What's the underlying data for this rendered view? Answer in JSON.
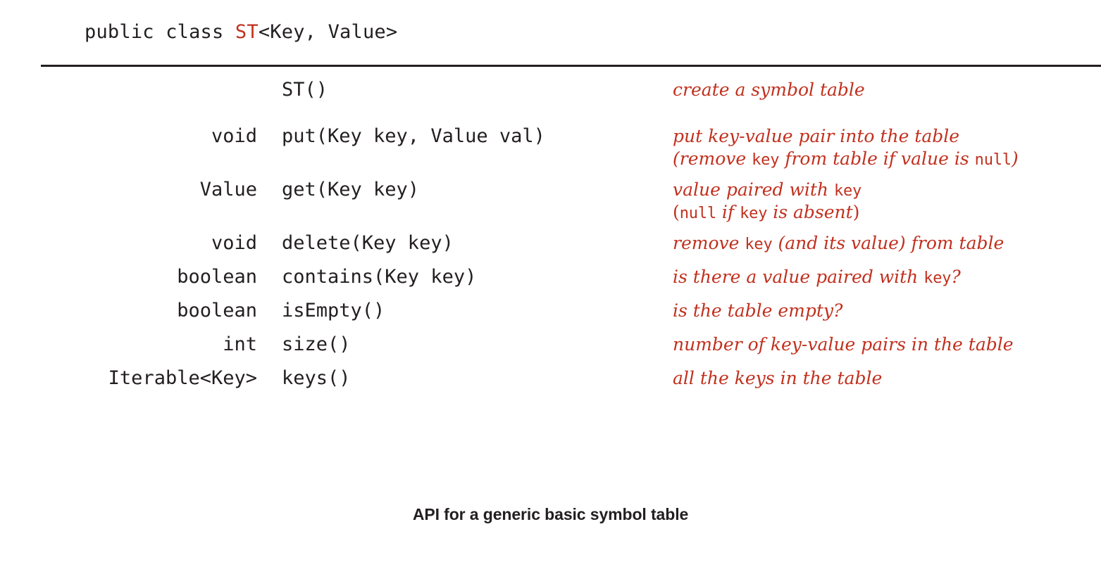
{
  "figure": {
    "caption": "API for a generic basic symbol table",
    "accent_color": "#c1301e",
    "text_color": "#231f20",
    "background_color": "#ffffff"
  },
  "class_declaration": {
    "modifiers": "public class ",
    "class_name": "ST",
    "generics": "<Key, Value>"
  },
  "methods": [
    {
      "return_type": "",
      "signature": "ST()",
      "description_lines": [
        {
          "parts": [
            {
              "text": "create a symbol table",
              "style": "italic"
            }
          ]
        }
      ]
    },
    {
      "return_type": "void",
      "signature": "put(Key key, Value val)",
      "description_lines": [
        {
          "parts": [
            {
              "text": "put key-value pair into the table",
              "style": "italic"
            }
          ]
        },
        {
          "parts": [
            {
              "text": "(remove ",
              "style": "italic"
            },
            {
              "text": "key",
              "style": "code"
            },
            {
              "text": " from table if value is ",
              "style": "italic"
            },
            {
              "text": "null",
              "style": "code"
            },
            {
              "text": ")",
              "style": "italic"
            }
          ]
        }
      ]
    },
    {
      "return_type": "Value",
      "signature": "get(Key key)",
      "description_lines": [
        {
          "parts": [
            {
              "text": "value paired with ",
              "style": "italic"
            },
            {
              "text": "key",
              "style": "code"
            }
          ]
        },
        {
          "parts": [
            {
              "text": "(",
              "style": "upright"
            },
            {
              "text": "null",
              "style": "code"
            },
            {
              "text": " if ",
              "style": "italic"
            },
            {
              "text": "key",
              "style": "code"
            },
            {
              "text": " is absent",
              "style": "italic"
            },
            {
              "text": ")",
              "style": "upright"
            }
          ]
        }
      ]
    },
    {
      "return_type": "void",
      "signature": "delete(Key key)",
      "description_lines": [
        {
          "parts": [
            {
              "text": "remove ",
              "style": "italic"
            },
            {
              "text": "key",
              "style": "code"
            },
            {
              "text": " (and its value) from table",
              "style": "italic"
            }
          ]
        }
      ]
    },
    {
      "return_type": "boolean",
      "signature": "contains(Key key)",
      "description_lines": [
        {
          "parts": [
            {
              "text": "is there a value paired with ",
              "style": "italic"
            },
            {
              "text": "key",
              "style": "code"
            },
            {
              "text": "?",
              "style": "italic"
            }
          ]
        }
      ]
    },
    {
      "return_type": "boolean",
      "signature": "isEmpty()",
      "description_lines": [
        {
          "parts": [
            {
              "text": "is the table empty?",
              "style": "italic"
            }
          ]
        }
      ]
    },
    {
      "return_type": "int",
      "signature": "size()",
      "description_lines": [
        {
          "parts": [
            {
              "text": "number of key-value pairs in the table",
              "style": "italic"
            }
          ]
        }
      ]
    },
    {
      "return_type": "Iterable<Key>",
      "signature": "keys()",
      "description_lines": [
        {
          "parts": [
            {
              "text": "all the keys in the table",
              "style": "italic"
            }
          ]
        }
      ]
    }
  ]
}
